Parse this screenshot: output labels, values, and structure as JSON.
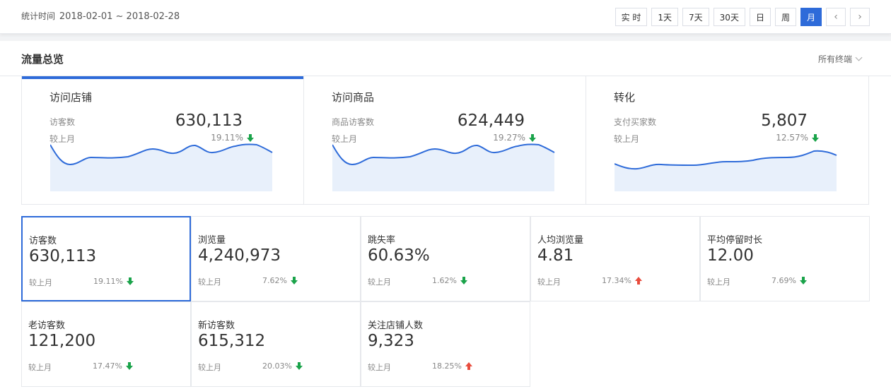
{
  "header": {
    "range_label": "统计时间",
    "range_value": "2018-02-01 ~ 2018-02-28",
    "periods": [
      "实 时",
      "1天",
      "7天",
      "30天",
      "日",
      "周",
      "月"
    ],
    "active_period": "月"
  },
  "panel": {
    "title": "流量总览",
    "terminal_label": "所有终端"
  },
  "cards": [
    {
      "title": "访问店铺",
      "sub_label": "访客数",
      "value": "630,113",
      "compare_label": "较上月",
      "change": "19.11%",
      "direction": "down",
      "active": true
    },
    {
      "title": "访问商品",
      "sub_label": "商品访客数",
      "value": "624,449",
      "compare_label": "较上月",
      "change": "19.27%",
      "direction": "down",
      "active": false
    },
    {
      "title": "转化",
      "sub_label": "支付买家数",
      "value": "5,807",
      "compare_label": "较上月",
      "change": "12.57%",
      "direction": "down",
      "active": false
    }
  ],
  "metrics": [
    {
      "label": "访客数",
      "value": "630,113",
      "compare_label": "较上月",
      "change": "19.11%",
      "direction": "down",
      "active": true
    },
    {
      "label": "浏览量",
      "value": "4,240,973",
      "compare_label": "较上月",
      "change": "7.62%",
      "direction": "down",
      "active": false
    },
    {
      "label": "跳失率",
      "value": "60.63%",
      "compare_label": "较上月",
      "change": "1.62%",
      "direction": "down",
      "active": false
    },
    {
      "label": "人均浏览量",
      "value": "4.81",
      "compare_label": "较上月",
      "change": "17.34%",
      "direction": "up",
      "active": false
    },
    {
      "label": "平均停留时长",
      "value": "12.00",
      "compare_label": "较上月",
      "change": "7.69%",
      "direction": "down",
      "active": false
    },
    {
      "label": "老访客数",
      "value": "121,200",
      "compare_label": "较上月",
      "change": "17.47%",
      "direction": "down",
      "active": false
    },
    {
      "label": "新访客数",
      "value": "615,312",
      "compare_label": "较上月",
      "change": "20.03%",
      "direction": "down",
      "active": false
    },
    {
      "label": "关注店铺人数",
      "value": "9,323",
      "compare_label": "较上月",
      "change": "18.25%",
      "direction": "up",
      "active": false
    }
  ],
  "colors": {
    "accent": "#2e6bd9",
    "down": "#1aa34a",
    "up": "#e84c3d",
    "spark_fill": "#e8f0fb"
  }
}
